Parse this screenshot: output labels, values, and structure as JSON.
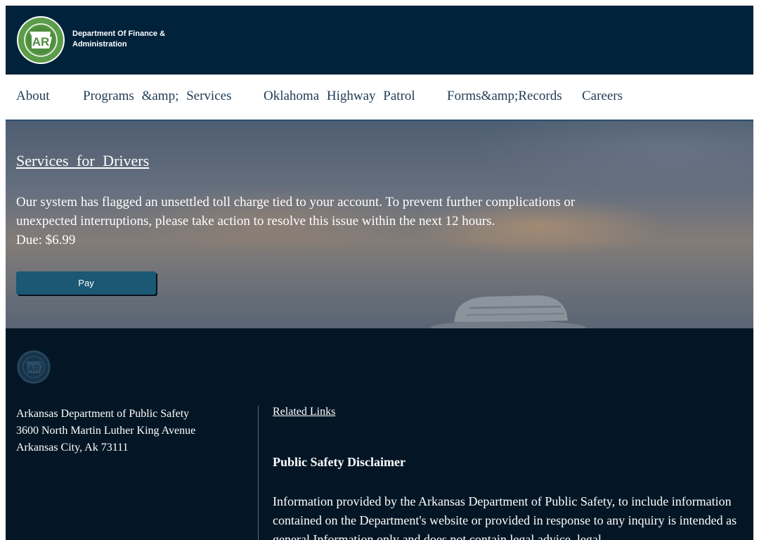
{
  "header": {
    "org_line1": "Department Of Finance &",
    "org_line2": "Administration",
    "logo_text": "AR"
  },
  "nav": {
    "items": [
      {
        "label": "About"
      },
      {
        "label": "Programs &amp; Services"
      },
      {
        "label": "Oklahoma Highway Patrol"
      },
      {
        "label": "Forms&amp;Records"
      },
      {
        "label": "Careers"
      }
    ]
  },
  "hero": {
    "title": "Services for Drivers",
    "message": "Our system has flagged an unsettled toll charge tied to your account. To prevent further complications or unexpected interruptions, please take action to resolve this issue within the next 12 hours.",
    "due": "Due: $6.99",
    "pay_label": "Pay"
  },
  "footer": {
    "logo_text": "AR",
    "address": {
      "line1": "Arkansas Department of Public Safety",
      "line2": "3600 North Martin Luther King Avenue",
      "line3": "Arkansas City, Ak 73111"
    },
    "related_links": "Related Links",
    "disclaimer_title": "Public Safety Disclaimer",
    "disclaimer_text": "Information provided by the Arkansas Department of Public Safety, to include information contained on the Department's website or provided in response to any inquiry is intended as general Information only and does not contain legal advice, legal"
  },
  "colors": {
    "header_bg": "#01223b",
    "nav_text": "#1f3a54",
    "pay_button": "#1a5873",
    "footer_bg": "#041625",
    "seal_green": "#5d9c4a"
  }
}
